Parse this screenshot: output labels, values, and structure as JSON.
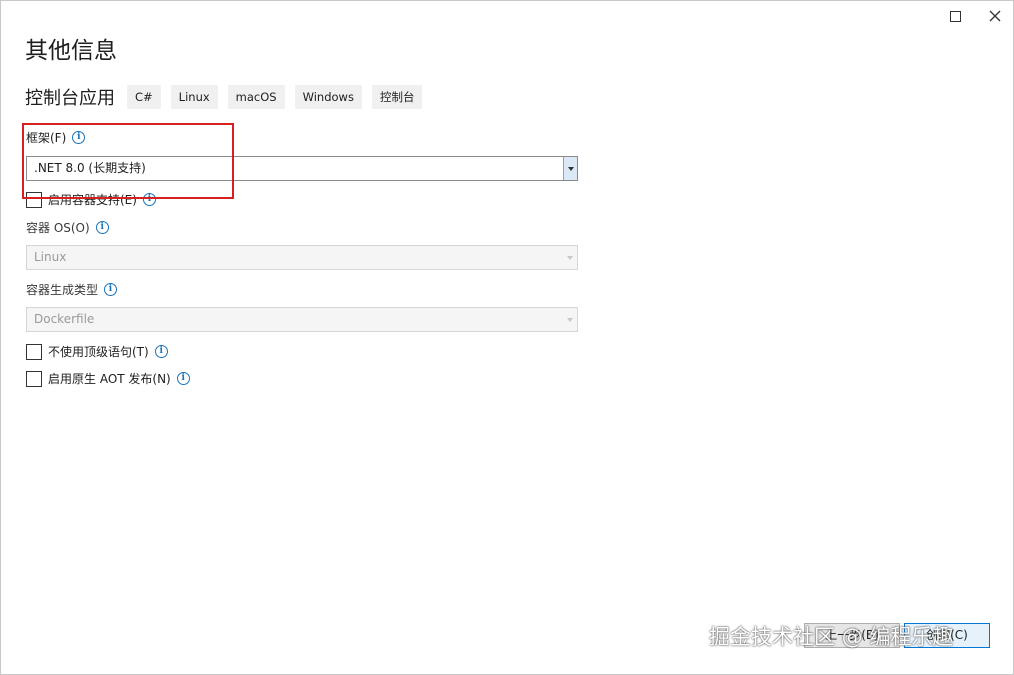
{
  "page": {
    "title": "其他信息",
    "app_name": "控制台应用",
    "tags": [
      "C#",
      "Linux",
      "macOS",
      "Windows",
      "控制台"
    ]
  },
  "framework": {
    "label": "框架(F)",
    "value": ".NET 8.0 (长期支持)"
  },
  "container_support": {
    "label": "启用容器支持(E)",
    "checked": false
  },
  "container_os": {
    "label": "容器 OS(O)",
    "value": "Linux"
  },
  "container_build_type": {
    "label": "容器生成类型",
    "value": "Dockerfile"
  },
  "no_top_level_statements": {
    "label": "不使用顶级语句(T)",
    "checked": false
  },
  "native_aot": {
    "label": "启用原生 AOT 发布(N)",
    "checked": false
  },
  "footer": {
    "back_label": "上一步(B)",
    "create_label": "创建(C)"
  },
  "watermark": "掘金技术社区 @ 编程乐趣",
  "colors": {
    "highlight": "#d92020",
    "info": "#1a73b8",
    "accent": "#0078d7"
  },
  "icons": {
    "close": "close-icon",
    "maximize": "maximize-icon",
    "info": "info-icon",
    "dropdown": "chevron-down-icon"
  }
}
